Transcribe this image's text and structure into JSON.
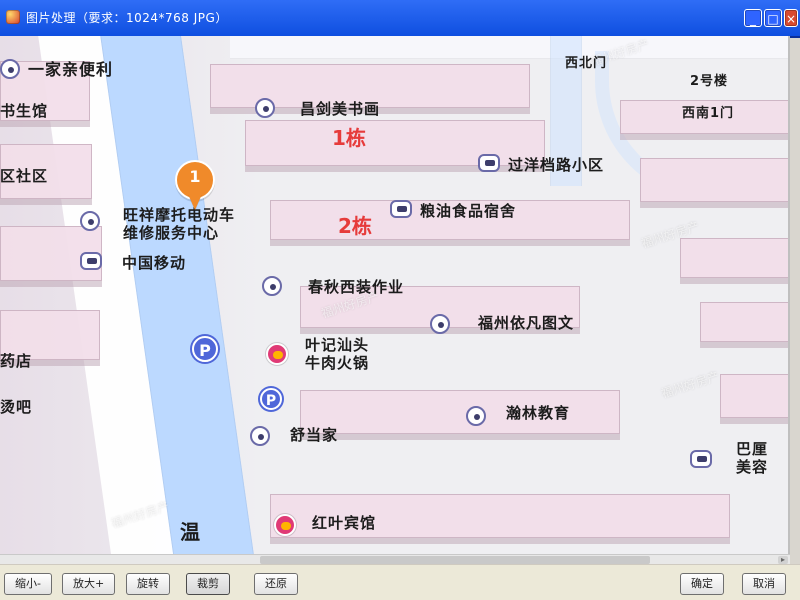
{
  "window": {
    "title": "图片处理（要求：1024*768 JPG）"
  },
  "map": {
    "pin_number": "1",
    "labels": {
      "one_shop": "一家亲便利",
      "library": "书生馆",
      "community": "区社区",
      "wanghuang": "旺祥摩托电动车\n维修服务中心",
      "china_mobile": "中国移动",
      "pharmacy": "药店",
      "salon": "烫吧",
      "changjian_art": "昌剑美书画",
      "building1": "1栋",
      "guoyang": "过洋档路小区",
      "building2": "2栋",
      "grain_oil": "粮油食品宿舍",
      "chunqiu": "春秋西装作业",
      "fuzhou": "福州依凡图文",
      "yeji": "叶记汕头\n牛肉火锅",
      "hanlin": "瀚林教育",
      "shudang": "舒当家",
      "bali": "巴厘\n美容",
      "hongye": "红叶宾馆",
      "west_north_gate": "西北门",
      "building2_number": "2号楼",
      "west_south_gate": "西南1门",
      "wen": "温"
    },
    "watermarks": [
      "福州好房产",
      "福州好房产",
      "福州好房产",
      "福州好房产",
      "福州好房产"
    ]
  },
  "toolbar": {
    "zoom_out": "缩小-",
    "zoom_in": "放大+",
    "rotate": "旋转",
    "crop": "裁剪",
    "reset": "还原",
    "ok": "确定",
    "cancel": "取消"
  },
  "icons": {
    "app": "app-icon",
    "minimize": "minimize-icon",
    "maximize": "maximize-icon",
    "close": "close-icon",
    "poi": "poi-icon",
    "parking": "parking-icon",
    "food": "food-icon",
    "pin": "location-pin-icon"
  },
  "colors": {
    "titlebar": "#1f5cf0",
    "road_blue": "#bcd9ff",
    "block_pink": "#f3dfea",
    "pin_orange": "#f08a2a",
    "label_red": "#e63b3b"
  }
}
